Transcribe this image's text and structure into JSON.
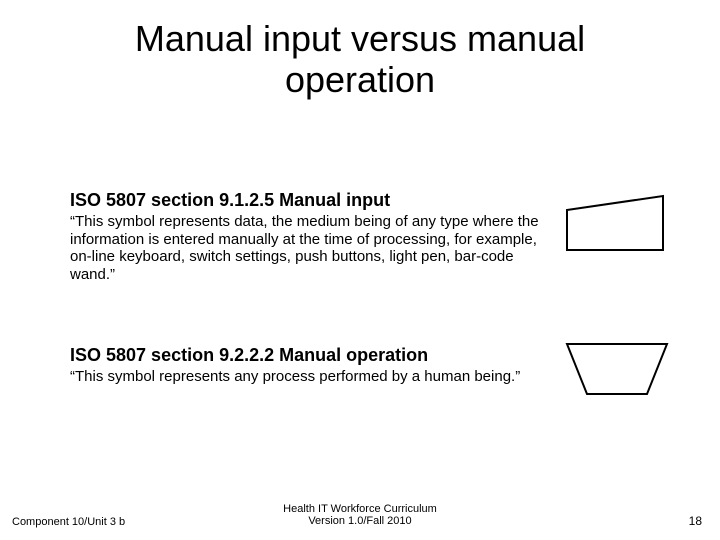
{
  "title": "Manual input versus manual\noperation",
  "sections": [
    {
      "heading": "ISO 5807 section 9.1.2.5 Manual input",
      "body": "“This symbol represents data, the medium being of any type where the information is entered manually at the time of processing, for example, on-line keyboard, switch settings, push buttons, light pen, bar-code wand.”"
    },
    {
      "heading": "ISO 5807 section 9.2.2.2 Manual operation",
      "body": "“This symbol represents any process performed by a human being.”"
    }
  ],
  "shapes": {
    "manual_input_icon": "manual-input-symbol",
    "manual_operation_icon": "manual-operation-symbol"
  },
  "footer": {
    "left": "Component 10/Unit 3 b",
    "center_line1": "Health IT Workforce Curriculum",
    "center_line2": "Version 1.0/Fall 2010",
    "page": "18"
  }
}
